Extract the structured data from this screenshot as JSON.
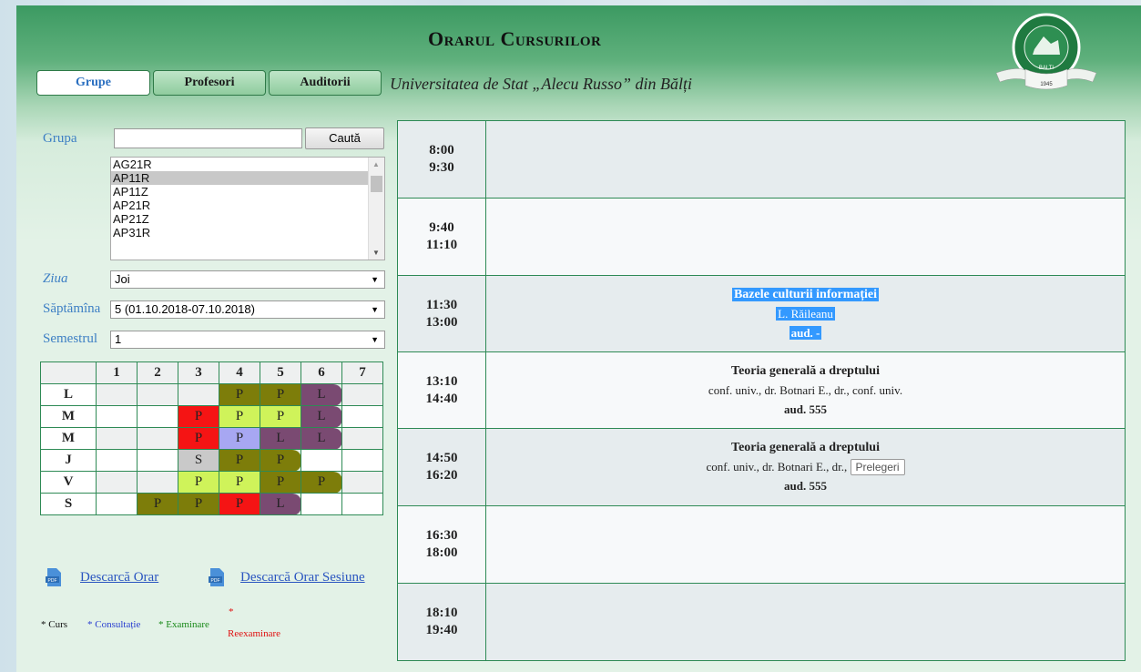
{
  "header": {
    "title": "Orarul Cursurilor",
    "subtitle": "Universitatea de Stat „Alecu Russo” din Bălți",
    "logo": {
      "top_text": "UNIVERSITATEA DE STAT „ALECU RUSSO”",
      "city": "BALTI",
      "year": "1945"
    }
  },
  "tabs": [
    {
      "label": "Grupe",
      "active": true
    },
    {
      "label": "Profesori",
      "active": false
    },
    {
      "label": "Auditorii",
      "active": false
    }
  ],
  "filters": {
    "group_label": "Grupa",
    "group_input_value": "",
    "search_button": "Caută",
    "group_list": [
      "AG21R",
      "AP11R",
      "AP11Z",
      "AP21R",
      "AP21Z",
      "AP31R"
    ],
    "group_selected": "AP11R",
    "day_label": "Ziua",
    "day_value": "Joi",
    "week_label": "Săptămîna",
    "week_value": "5 (01.10.2018-07.10.2018)",
    "semester_label": "Semestrul",
    "semester_value": "1"
  },
  "week_grid": {
    "columns": [
      "1",
      "2",
      "3",
      "4",
      "5",
      "6",
      "7"
    ],
    "rows": [
      {
        "day": "L",
        "cells": [
          "",
          "",
          "",
          "P",
          "P",
          "L",
          ""
        ]
      },
      {
        "day": "M",
        "cells": [
          "",
          "",
          "P",
          "P",
          "P",
          "L",
          ""
        ]
      },
      {
        "day": "M",
        "cells": [
          "",
          "",
          "P",
          "P",
          "L",
          "L",
          ""
        ]
      },
      {
        "day": "J",
        "cells": [
          "",
          "",
          "S",
          "P",
          "P",
          "",
          ""
        ]
      },
      {
        "day": "V",
        "cells": [
          "",
          "",
          "P",
          "P",
          "P",
          "P",
          ""
        ]
      },
      {
        "day": "S",
        "cells": [
          "",
          "P",
          "P",
          "P",
          "L",
          "",
          ""
        ]
      }
    ],
    "colors": {
      "olive": "#7d7d0a",
      "purple": "#7a4a72",
      "red": "#f51414",
      "lime": "#cff35a",
      "lavender": "#a7a7f2",
      "grey": "#c9c9c9"
    }
  },
  "downloads": {
    "schedule": "Descarcă Orar",
    "session": "Descarcă Orar Sesiune",
    "icon": "pdf-icon"
  },
  "legend": {
    "curs": "* Curs",
    "consultatie": "* Consultație",
    "examinare": "* Examinare",
    "reexaminare_star": "*",
    "reexaminare": "Reexaminare"
  },
  "schedule": [
    {
      "start": "8:00",
      "end": "9:30"
    },
    {
      "start": "9:40",
      "end": "11:10"
    },
    {
      "start": "11:30",
      "end": "13:00",
      "course": "Bazele culturii informației",
      "teacher": "L. Răileanu",
      "room": "aud. -"
    },
    {
      "start": "13:10",
      "end": "14:40",
      "course": "Teoria generală a dreptului",
      "teacher": "conf. univ., dr. Botnari E., dr., conf. univ.",
      "room": "aud. 555"
    },
    {
      "start": "14:50",
      "end": "16:20",
      "course": "Teoria generală a dreptului",
      "teacher": "conf. univ., dr. Botnari E., dr.,",
      "type_tag": "Prelegeri",
      "room": "aud. 555"
    },
    {
      "start": "16:30",
      "end": "18:00"
    },
    {
      "start": "18:10",
      "end": "19:40"
    }
  ]
}
